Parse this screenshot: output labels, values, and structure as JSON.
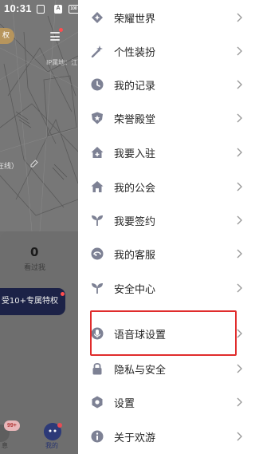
{
  "status_bar": {
    "time": "10:31",
    "icons": [
      "sim-icon",
      "notification-a-icon",
      "battery-icon"
    ],
    "icon_glyphs": [
      "",
      "A",
      "100"
    ]
  },
  "background_profile": {
    "badge_text": "权",
    "ip_text": "IP属地：江西",
    "online_text": "在线）",
    "viewed_count": "0",
    "viewed_label": "看过我",
    "privilege_button": "受10+专属特权",
    "tab_left_badge": "99+",
    "tab_left_label": "息",
    "tab_mine_label": "我的"
  },
  "drawer": {
    "accent_color": "#7d8194",
    "highlight_color": "#e02c2c",
    "items": [
      {
        "label": "荣耀世界",
        "icon": "diamond-star-icon"
      },
      {
        "label": "个性装扮",
        "icon": "magic-wand-icon"
      },
      {
        "label": "我的记录",
        "icon": "clock-icon"
      },
      {
        "label": "荣誉殿堂",
        "icon": "shield-star-icon"
      },
      {
        "label": "我要入驻",
        "icon": "home-add-icon"
      },
      {
        "label": "我的公会",
        "icon": "guild-house-icon"
      },
      {
        "label": "我要签约",
        "icon": "sprout-icon"
      },
      {
        "label": "我的客服",
        "icon": "customer-service-icon"
      },
      {
        "label": "安全中心",
        "icon": "sprout-icon"
      },
      {
        "label": "语音球设置",
        "icon": "microphone-icon",
        "highlighted": true
      },
      {
        "label": "隐私与安全",
        "icon": "lock-icon"
      },
      {
        "label": "设置",
        "icon": "gear-icon"
      },
      {
        "label": "关于欢游",
        "icon": "info-icon"
      }
    ]
  }
}
